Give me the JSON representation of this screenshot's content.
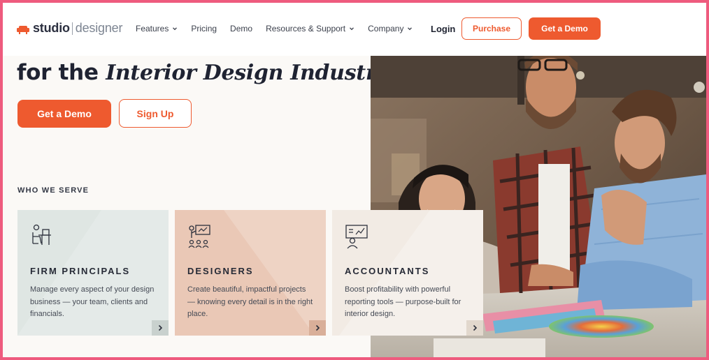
{
  "logo": {
    "word_a": "studio",
    "word_b": "designer",
    "icon": "sofa-icon"
  },
  "nav": {
    "items": [
      {
        "label": "Features",
        "has_dropdown": true
      },
      {
        "label": "Pricing",
        "has_dropdown": false
      },
      {
        "label": "Demo",
        "has_dropdown": false
      },
      {
        "label": "Resources & Support",
        "has_dropdown": true
      },
      {
        "label": "Company",
        "has_dropdown": true
      }
    ],
    "login": "Login",
    "purchase": "Purchase",
    "get_demo": "Get a Demo"
  },
  "hero": {
    "title_plain": "for the",
    "title_italic": "Interior Design Industry",
    "cta_demo": "Get a Demo",
    "cta_signup": "Sign Up"
  },
  "who_we_serve": {
    "heading": "WHO WE SERVE",
    "cards": [
      {
        "title": "FIRM PRINCIPALS",
        "desc": "Manage every aspect of your design business — your team, clients and financials.",
        "icon": "desk-person-icon"
      },
      {
        "title": "DESIGNERS",
        "desc": "Create beautiful, impactful projects — knowing every detail is in the right place.",
        "icon": "presentation-icon"
      },
      {
        "title": "ACCOUNTANTS",
        "desc": "Boost profitability with powerful reporting tools — purpose-built for interior design.",
        "icon": "analytics-board-icon"
      }
    ]
  },
  "colors": {
    "accent": "#ee5a2f",
    "frame": "#ee5b7e",
    "text_dark": "#1f2332"
  }
}
